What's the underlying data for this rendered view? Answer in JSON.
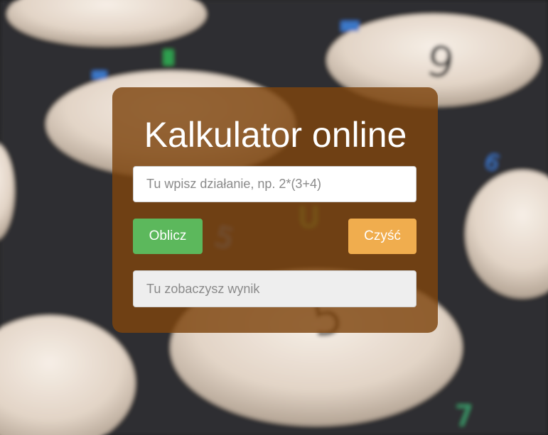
{
  "app": {
    "title": "Kalkulator online"
  },
  "form": {
    "expression_placeholder": "Tu wpisz działanie, np. 2*(3+4)",
    "expression_value": "",
    "calculate_label": "Oblicz",
    "clear_label": "Czyść",
    "result_placeholder": "Tu zobaczysz wynik",
    "result_value": ""
  },
  "colors": {
    "panel_overlay": "#7e440e",
    "calculate_button": "#5cb85c",
    "clear_button": "#f0ad4e",
    "title_text": "#ffffff"
  },
  "background": {
    "image_subject": "calculator-keypad-photo",
    "key_glyphs": [
      "9",
      "9",
      "6",
      "5",
      "5",
      "U",
      "7"
    ]
  }
}
